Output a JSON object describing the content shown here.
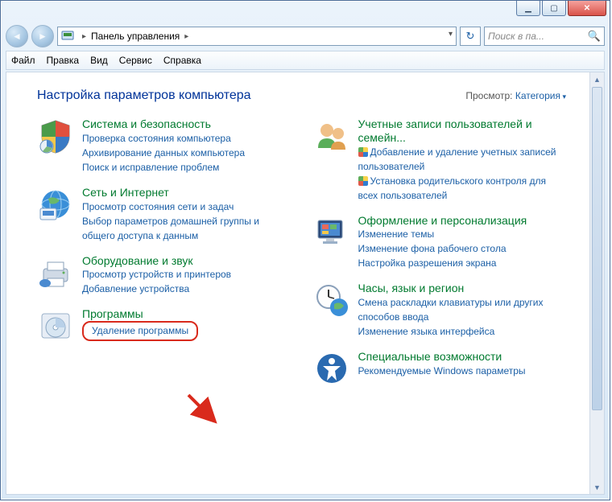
{
  "window": {
    "breadcrumb_root": "Панель управления",
    "search_placeholder": "Поиск в па...",
    "menu": [
      "Файл",
      "Правка",
      "Вид",
      "Сервис",
      "Справка"
    ]
  },
  "header": {
    "title": "Настройка параметров компьютера",
    "viewby_label": "Просмотр:",
    "viewby_value": "Категория"
  },
  "left_categories": [
    {
      "icon": "shield",
      "name": "Система и безопасность",
      "links": [
        {
          "text": "Проверка состояния компьютера"
        },
        {
          "text": "Архивирование данных компьютера"
        },
        {
          "text": "Поиск и исправление проблем"
        }
      ]
    },
    {
      "icon": "globe",
      "name": "Сеть и Интернет",
      "links": [
        {
          "text": "Просмотр состояния сети и задач"
        },
        {
          "text": "Выбор параметров домашней группы и общего доступа к данным"
        }
      ]
    },
    {
      "icon": "printer",
      "name": "Оборудование и звук",
      "links": [
        {
          "text": "Просмотр устройств и принтеров"
        },
        {
          "text": "Добавление устройства"
        }
      ]
    },
    {
      "icon": "disc",
      "name": "Программы",
      "links": [
        {
          "text": "Удаление программы",
          "highlight": true
        }
      ]
    }
  ],
  "right_categories": [
    {
      "icon": "users",
      "name": "Учетные записи пользователей и семейн...",
      "links": [
        {
          "text": "Добавление и удаление учетных записей пользователей",
          "shield": true
        },
        {
          "text": "Установка родительского контроля для всех пользователей",
          "shield": true
        }
      ]
    },
    {
      "icon": "appearance",
      "name": "Оформление и персонализация",
      "links": [
        {
          "text": "Изменение темы"
        },
        {
          "text": "Изменение фона рабочего стола"
        },
        {
          "text": "Настройка разрешения экрана"
        }
      ]
    },
    {
      "icon": "clock",
      "name": "Часы, язык и регион",
      "links": [
        {
          "text": "Смена раскладки клавиатуры или других способов ввода"
        },
        {
          "text": "Изменение языка интерфейса"
        }
      ]
    },
    {
      "icon": "access",
      "name": "Специальные возможности",
      "links": [
        {
          "text": "Рекомендуемые Windows параметры"
        }
      ]
    }
  ]
}
